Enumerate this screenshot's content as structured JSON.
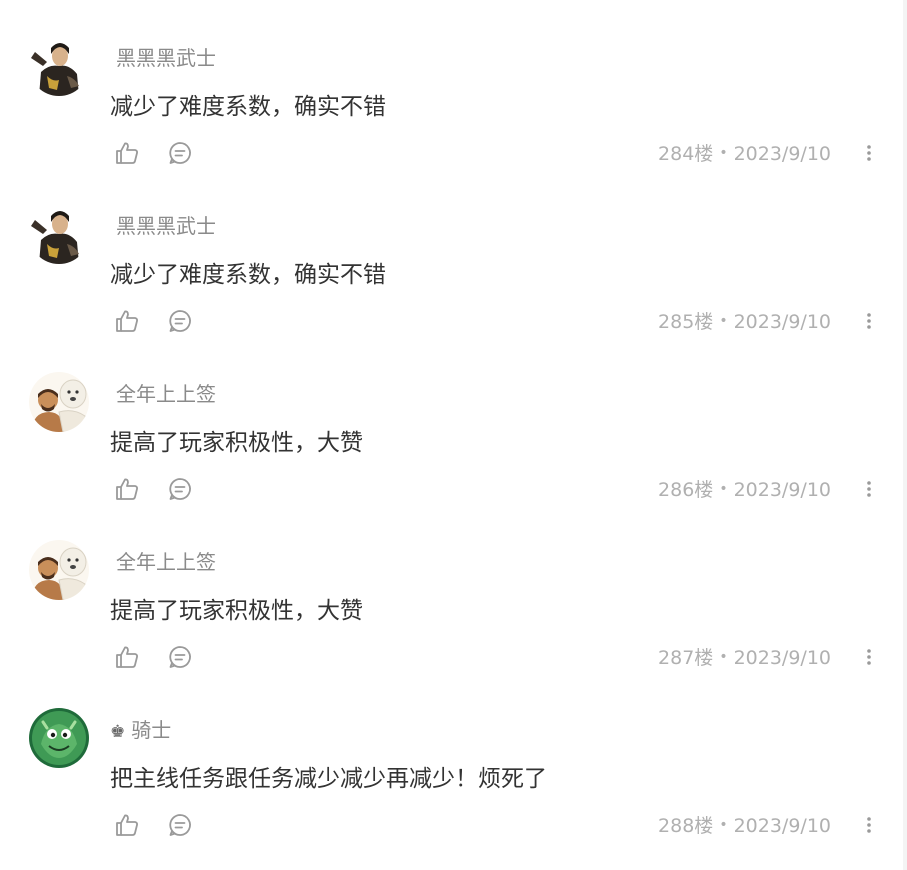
{
  "comments": [
    {
      "user": "黑黑黑武士",
      "badge": "",
      "avatar": "knight-avatar",
      "text": "减少了难度系数，确实不错",
      "floor": "284楼",
      "date": "2023/9/10"
    },
    {
      "user": "黑黑黑武士",
      "badge": "",
      "avatar": "knight-avatar",
      "text": "减少了难度系数，确实不错",
      "floor": "285楼",
      "date": "2023/9/10"
    },
    {
      "user": "全年上上签",
      "badge": "",
      "avatar": "bear-hug-avatar",
      "text": "提高了玩家积极性，大赞",
      "floor": "286楼",
      "date": "2023/9/10"
    },
    {
      "user": "全年上上签",
      "badge": "",
      "avatar": "bear-hug-avatar",
      "text": "提高了玩家积极性，大赞",
      "floor": "287楼",
      "date": "2023/9/10"
    },
    {
      "user": "骑士",
      "badge": "♚",
      "avatar": "green-monster-avatar",
      "text": "把主线任务跟任务减少减少再减少！烦死了",
      "floor": "288楼",
      "date": "2023/9/10"
    }
  ],
  "icons": {
    "like": "thumbs-up-icon",
    "reply": "comment-icon",
    "more": "more-vertical-icon"
  },
  "colors": {
    "username": "#8a8a8a",
    "content": "#333333",
    "meta": "#b0b0b0",
    "icon": "#9a9a9a"
  }
}
